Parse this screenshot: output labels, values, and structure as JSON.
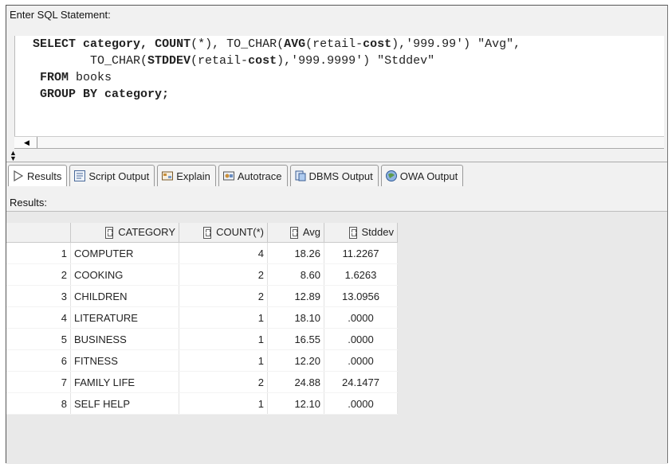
{
  "editor": {
    "label": "Enter SQL Statement:",
    "sql_lines": [
      [
        {
          "t": "SELECT",
          "b": true
        },
        {
          "t": " "
        },
        {
          "t": "category,",
          "b": true
        },
        {
          "t": " "
        },
        {
          "t": "COUNT",
          "b": true
        },
        {
          "t": "(*), TO_CHAR("
        },
        {
          "t": "AVG",
          "b": true
        },
        {
          "t": "(retail-"
        },
        {
          "t": "cost",
          "b": true
        },
        {
          "t": "),'999.99') \"Avg\","
        }
      ],
      [
        {
          "t": "        TO_CHAR("
        },
        {
          "t": "STDDEV",
          "b": true
        },
        {
          "t": "(retail-"
        },
        {
          "t": "cost",
          "b": true
        },
        {
          "t": "),'999.9999') \"Stddev\""
        }
      ],
      [
        {
          "t": " "
        },
        {
          "t": "FROM",
          "b": true
        },
        {
          "t": " books"
        }
      ],
      [
        {
          "t": " "
        },
        {
          "t": "GROUP BY category;",
          "b": true
        }
      ]
    ]
  },
  "tabs": [
    {
      "label": "Results",
      "icon": "play-icon"
    },
    {
      "label": "Script Output",
      "icon": "script-icon"
    },
    {
      "label": "Explain",
      "icon": "explain-icon"
    },
    {
      "label": "Autotrace",
      "icon": "autotrace-icon"
    },
    {
      "label": "DBMS Output",
      "icon": "dbms-icon"
    },
    {
      "label": "OWA Output",
      "icon": "owa-icon"
    }
  ],
  "results": {
    "label": "Results:",
    "columns": [
      "CATEGORY",
      "COUNT(*)",
      "Avg",
      "Stddev"
    ],
    "rows": [
      {
        "n": "1",
        "category": "COMPUTER",
        "count": "4",
        "avg": "18.26",
        "stddev": "11.2267"
      },
      {
        "n": "2",
        "category": "COOKING",
        "count": "2",
        "avg": "8.60",
        "stddev": "1.6263"
      },
      {
        "n": "3",
        "category": "CHILDREN",
        "count": "2",
        "avg": "12.89",
        "stddev": "13.0956"
      },
      {
        "n": "4",
        "category": "LITERATURE",
        "count": "1",
        "avg": "18.10",
        "stddev": ".0000"
      },
      {
        "n": "5",
        "category": "BUSINESS",
        "count": "1",
        "avg": "16.55",
        "stddev": ".0000"
      },
      {
        "n": "6",
        "category": "FITNESS",
        "count": "1",
        "avg": "12.20",
        "stddev": ".0000"
      },
      {
        "n": "7",
        "category": "FAMILY LIFE",
        "count": "2",
        "avg": "24.88",
        "stddev": "24.1477"
      },
      {
        "n": "8",
        "category": "SELF HELP",
        "count": "1",
        "avg": "12.10",
        "stddev": ".0000"
      }
    ]
  }
}
